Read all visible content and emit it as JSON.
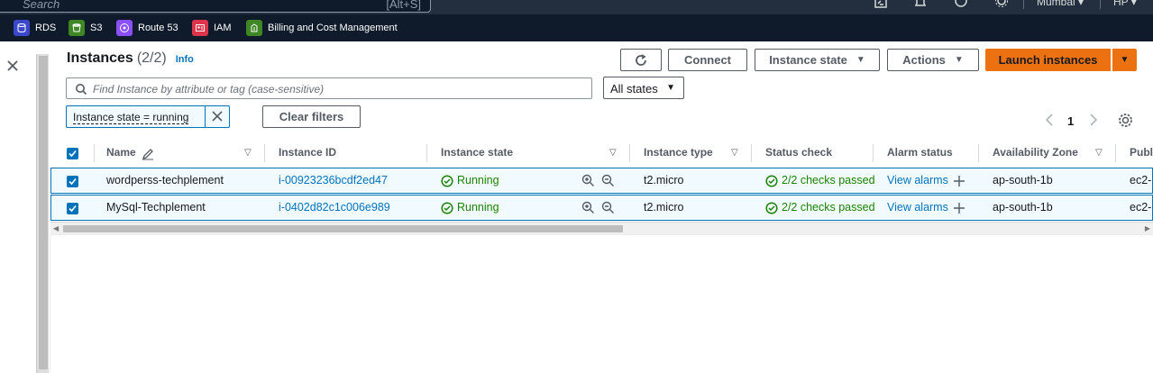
{
  "topbar": {
    "search_placeholder": "Search",
    "search_shortcut": "[Alt+S]",
    "region": "Mumbai ▾",
    "user": "HP ▾",
    "icons": [
      "cloudshell-icon",
      "bell-icon",
      "help-icon",
      "gear-icon"
    ]
  },
  "favorites": [
    {
      "label": "RDS",
      "color": "#3b48cc",
      "icon": "rds-icon"
    },
    {
      "label": "S3",
      "color": "#3f8624",
      "icon": "s3-icon"
    },
    {
      "label": "Route 53",
      "color": "#8c4fff",
      "icon": "route53-icon"
    },
    {
      "label": "IAM",
      "color": "#dd344c",
      "icon": "iam-icon"
    },
    {
      "label": "Billing and Cost Management",
      "color": "#3f8624",
      "icon": "billing-icon"
    }
  ],
  "header": {
    "title": "Instances",
    "count": "(2/2)",
    "info": "Info",
    "connect": "Connect",
    "instance_state": "Instance state",
    "actions": "Actions",
    "launch": "Launch instances"
  },
  "filters": {
    "search_placeholder": "Find Instance by attribute or tag (case-sensitive)",
    "states_select": "All states",
    "token": "Instance state = running",
    "clear": "Clear filters"
  },
  "pagination": {
    "page": "1"
  },
  "table": {
    "columns": [
      "Name",
      "Instance ID",
      "Instance state",
      "Instance type",
      "Status check",
      "Alarm status",
      "Availability Zone",
      "Publ"
    ],
    "rows": [
      {
        "name": "wordperss-techplement",
        "id": "i-00923236bcdf2ed47",
        "state": "Running",
        "type": "t2.micro",
        "status": "2/2 checks passed",
        "alarm": "View alarms",
        "az": "ap-south-1b",
        "public": "ec2-"
      },
      {
        "name": "MySql-Techplement",
        "id": "i-0402d82c1c006e989",
        "state": "Running",
        "type": "t2.micro",
        "status": "2/2 checks passed",
        "alarm": "View alarms",
        "az": "ap-south-1b",
        "public": "ec2-"
      }
    ]
  },
  "colors": {
    "accent": "#0073bb",
    "primary": "#ec7211",
    "success": "#1d8102",
    "nav": "#232f3e"
  }
}
